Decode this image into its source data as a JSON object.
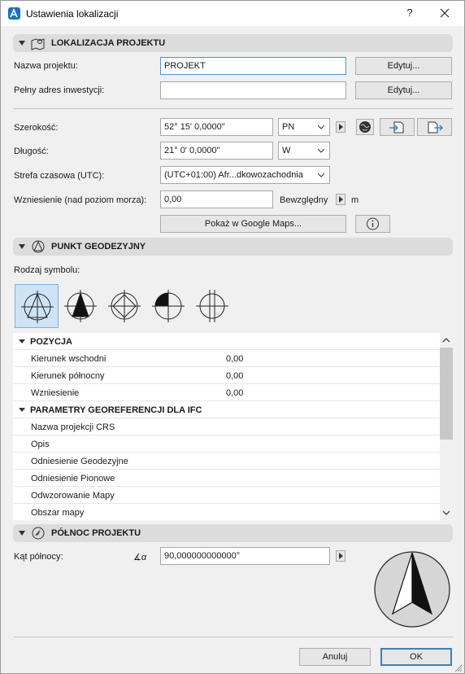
{
  "window": {
    "title": "Ustawienia lokalizacji",
    "help": "?"
  },
  "project": {
    "section_title": "LOKALIZACJA PROJEKTU",
    "name_label": "Nazwa projektu:",
    "name_value": "PROJEKT",
    "address_label": "Pełny adres inwestycji:",
    "address_value": "",
    "edit_label": "Edytuj...",
    "edit_label2": "Edytuj...",
    "latitude_label": "Szerokość:",
    "latitude_value": "52° 15' 0,0000\"",
    "latitude_dir": "PN",
    "longitude_label": "Długość:",
    "longitude_value": "21° 0' 0,0000\"",
    "longitude_dir": "W",
    "timezone_label": "Strefa czasowa (UTC):",
    "timezone_value": "(UTC+01:00) Afr...dkowozachodnia",
    "elevation_label": "Wzniesienie (nad poziom morza):",
    "elevation_value": "0,00",
    "elevation_mode": "Bewzględny",
    "elevation_unit": "m",
    "maps_button": "Pokaż w Google Maps..."
  },
  "geodetic": {
    "section_title": "PUNKT GEODEZYJNY",
    "symbol_label": "Rodzaj symbolu:"
  },
  "list": {
    "groups": [
      {
        "title": "POZYCJA",
        "rows": [
          {
            "label": "Kierunek wschodni",
            "value": "0,00"
          },
          {
            "label": "Kierunek północny",
            "value": "0,00"
          },
          {
            "label": "Wzniesienie",
            "value": "0,00"
          }
        ]
      },
      {
        "title": "PARAMETRY GEOREFERENCJI DLA IFC",
        "rows": [
          {
            "label": "Nazwa projekcji CRS",
            "value": ""
          },
          {
            "label": "Opis",
            "value": ""
          },
          {
            "label": "Odniesienie Geodezyjne",
            "value": ""
          },
          {
            "label": "Odniesienie Pionowe",
            "value": ""
          },
          {
            "label": "Odwzorowanie Mapy",
            "value": ""
          },
          {
            "label": "Obszar mapy",
            "value": ""
          }
        ]
      }
    ]
  },
  "north": {
    "section_title": "PÓŁNOC PROJEKTU",
    "angle_label": "Kąt północy:",
    "angle_value": "90,000000000000°",
    "angle_symbol": "∡α"
  },
  "footer": {
    "cancel": "Anuluj",
    "ok": "OK"
  },
  "colors": {
    "accent": "#3b7fc4",
    "section_bg": "#dcdcdc",
    "selection_bg": "#cfe3f7"
  }
}
